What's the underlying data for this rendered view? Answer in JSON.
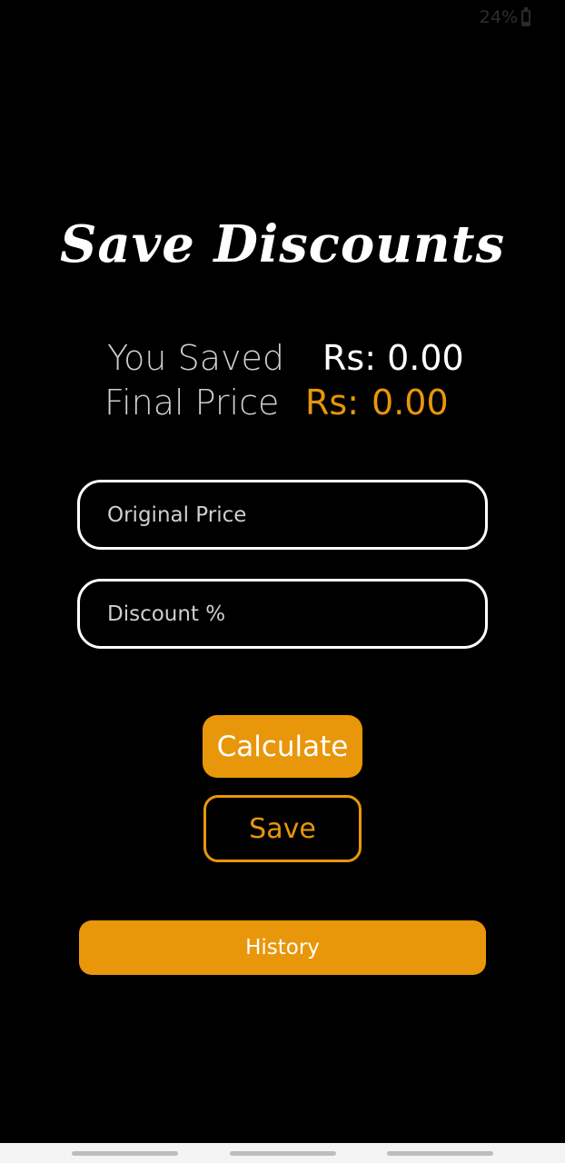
{
  "status_bar": {
    "battery_text": "24%",
    "battery_icon": "battery-icon"
  },
  "title": "Save Discounts",
  "summary": {
    "saved_label": "You Saved",
    "saved_currency": "Rs:",
    "saved_amount": "0.00",
    "final_label": "Final Price",
    "final_currency": "Rs:",
    "final_amount": "0.00"
  },
  "form": {
    "original_price_placeholder": "Original Price",
    "original_price_value": "",
    "discount_placeholder": "Discount %",
    "discount_value": ""
  },
  "buttons": {
    "calculate": "Calculate",
    "save": "Save",
    "history": "History"
  },
  "colors": {
    "accent": "#e8960a",
    "background": "#000000",
    "text": "#ffffff"
  }
}
